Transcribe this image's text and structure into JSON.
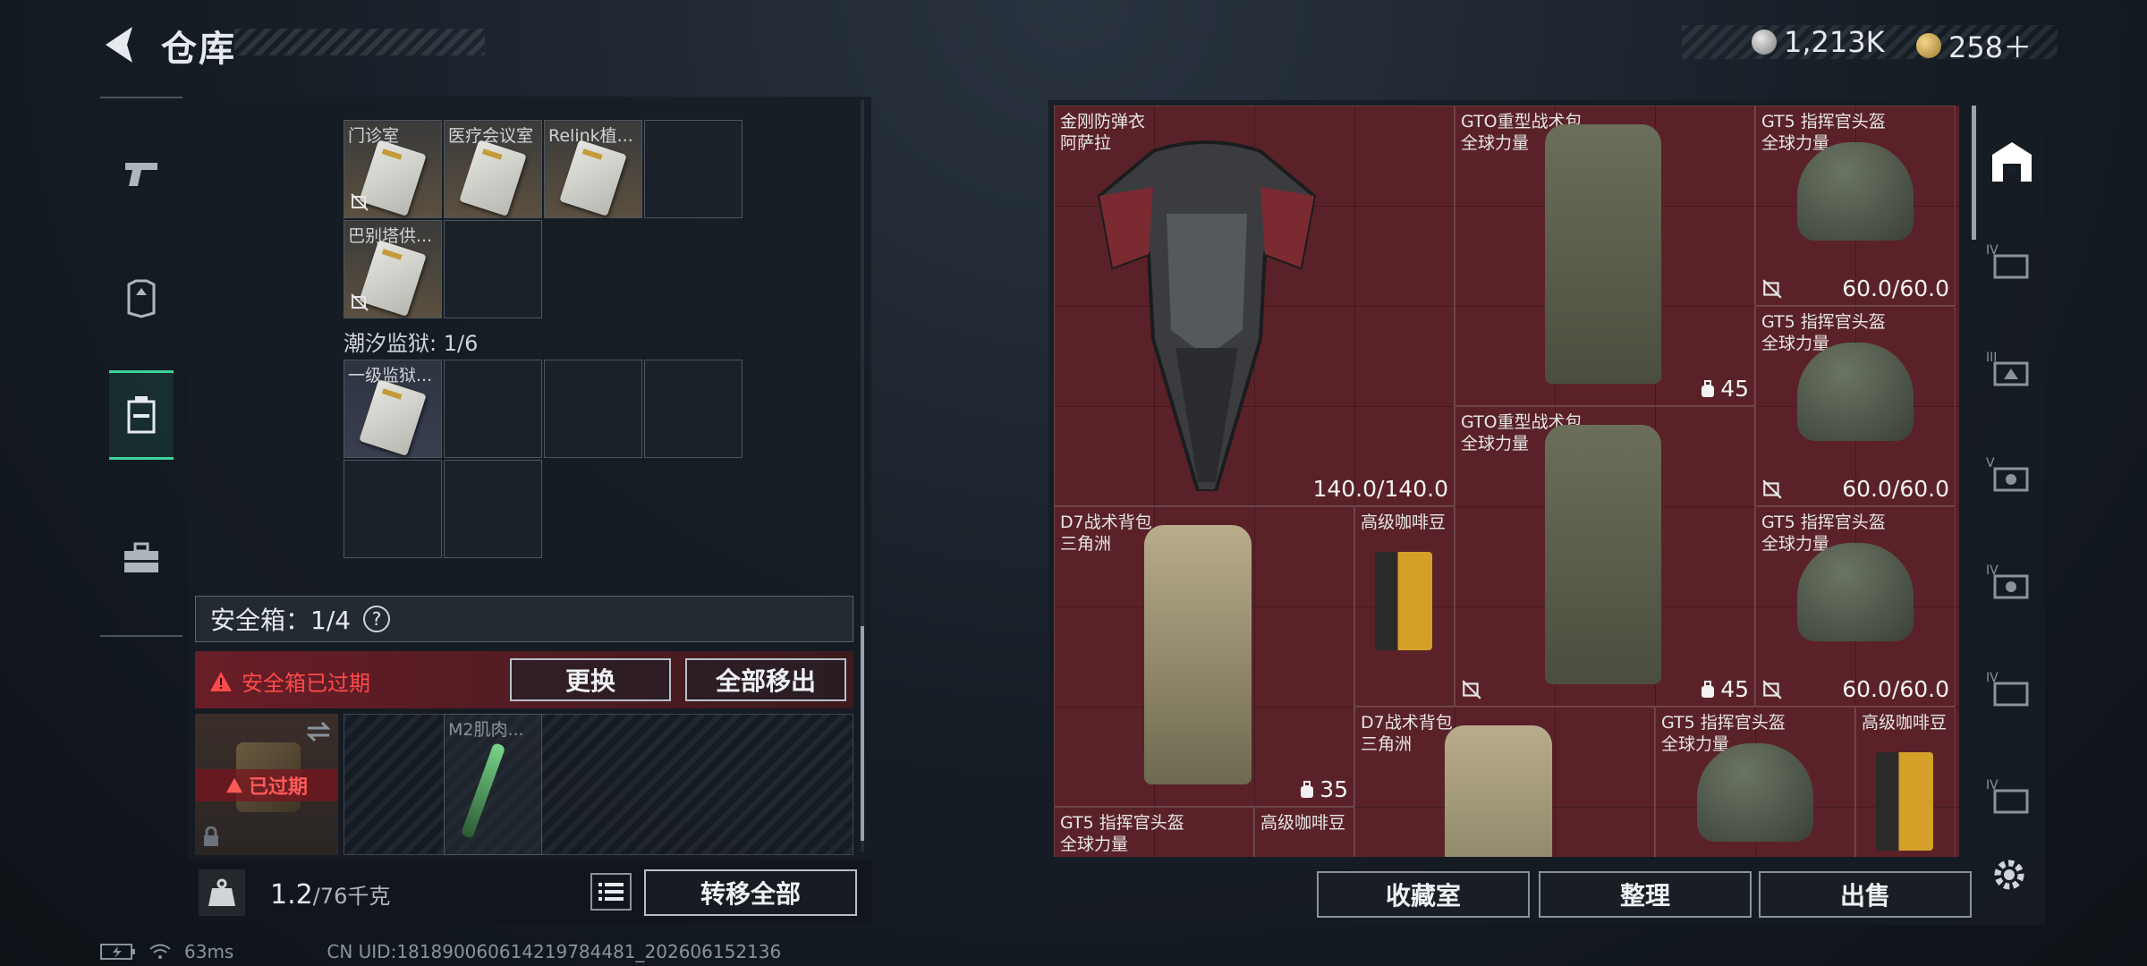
{
  "header": {
    "title": "仓库"
  },
  "currency": [
    {
      "icon": "silver-coin-icon",
      "value": "1,213K"
    },
    {
      "icon": "gold-coin-icon",
      "value": "258＋"
    }
  ],
  "left": {
    "section1": {
      "items": [
        {
          "name": "门诊室"
        },
        {
          "name": "医疗会议室"
        },
        {
          "name": "Relink植..."
        },
        {
          "name": "巴别塔供..."
        }
      ]
    },
    "section2": {
      "label": "潮汐监狱: 1/6",
      "items": [
        {
          "name": "一级监狱..."
        }
      ]
    },
    "safe": {
      "label": "安全箱：1/4",
      "help": "?",
      "expired_text": "安全箱已过期",
      "replace_label": "更换",
      "remove_all_label": "全部移出",
      "box_status": "已过期",
      "slot_item": "M2肌肉..."
    },
    "footer": {
      "weight": "1.2",
      "capacity": "/76千克",
      "transfer_label": "转移全部"
    }
  },
  "stash": {
    "items": [
      {
        "name": "金刚防弹衣",
        "sub": "阿萨拉",
        "value": "140.0/140.0"
      },
      {
        "name": "GTO重型战术包",
        "sub": "全球力量",
        "count": "45"
      },
      {
        "name": "GT5 指挥官头盔",
        "sub": "全球力量",
        "value": "60.0/60.0"
      },
      {
        "name": "GT5 指挥官头盔",
        "sub": "全球力量",
        "value": "60.0/60.0"
      },
      {
        "name": "GTO重型战术包",
        "sub": "全球力量",
        "count": "45"
      },
      {
        "name": "D7战术背包",
        "sub": "三角洲",
        "count": "35"
      },
      {
        "name": "高级咖啡豆"
      },
      {
        "name": "GT5 指挥官头盔",
        "sub": "全球力量",
        "value": "60.0/60.0"
      },
      {
        "name": "D7战术背包",
        "sub": "三角洲"
      },
      {
        "name": "GT5 指挥官头盔",
        "sub": "全球力量"
      },
      {
        "name": "高级咖啡豆"
      },
      {
        "name": "GT5 指挥官头盔",
        "sub": "全球力量"
      },
      {
        "name": "高级咖啡豆"
      }
    ]
  },
  "actions": {
    "collection_label": "收藏室",
    "sort_label": "整理",
    "sell_label": "出售"
  },
  "rail_right": [
    "IV",
    "III",
    "V",
    "IV",
    "IV",
    "IV"
  ],
  "status": {
    "ping": "63ms",
    "uid": "CN UID:181890060614219784481_202606152136"
  },
  "colors": {
    "accent": "#3fd29c",
    "warning": "#ff4a4a",
    "stash_bg": "#5a2228"
  }
}
